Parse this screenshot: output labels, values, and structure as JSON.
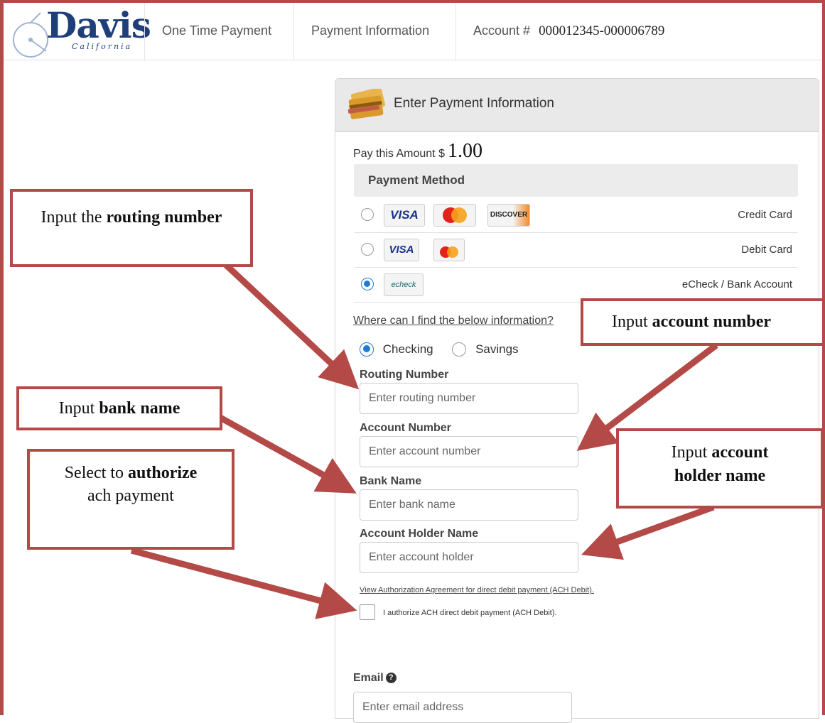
{
  "header": {
    "logo_text": "Davis",
    "logo_sub": "California",
    "nav": [
      "One Time Payment",
      "Payment Information"
    ],
    "account_label": "Account #",
    "account_number": "000012345-000006789"
  },
  "panel": {
    "title": "Enter Payment Information",
    "amount_label": "Pay this Amount $",
    "amount_value": "1.00",
    "payment_method_heading": "Payment Method",
    "methods": [
      {
        "label": "Credit Card",
        "selected": false,
        "logos": [
          "VISA",
          "MasterCard",
          "DISCOVER"
        ]
      },
      {
        "label": "Debit Card",
        "selected": false,
        "logos": [
          "VISA",
          "Debit"
        ]
      },
      {
        "label": "eCheck / Bank Account",
        "selected": true,
        "logos": [
          "echeck"
        ]
      }
    ],
    "where_link": "Where can I find the below information?",
    "account_types": {
      "checking": "Checking",
      "savings": "Savings",
      "selected": "checking"
    },
    "fields": {
      "routing": {
        "label": "Routing Number",
        "placeholder": "Enter routing number"
      },
      "account": {
        "label": "Account Number",
        "placeholder": "Enter account number"
      },
      "bank": {
        "label": "Bank Name",
        "placeholder": "Enter bank name"
      },
      "holder": {
        "label": "Account Holder Name",
        "placeholder": "Enter account holder"
      }
    },
    "auth_link": "View Authorization Agreement for direct debit payment (ACH Debit).",
    "auth_checkbox": "I authorize ACH direct debit payment (ACH Debit).",
    "email": {
      "label": "Email",
      "placeholder": "Enter email address"
    }
  },
  "callouts": {
    "routing": {
      "pre": "Input the ",
      "bold": "routing number",
      "post": ""
    },
    "account": {
      "pre": "Input ",
      "bold": "account number",
      "post": ""
    },
    "bank": {
      "pre": "Input ",
      "bold": "bank name",
      "post": ""
    },
    "authorize": {
      "pre": "Select to ",
      "bold": "authorize",
      "post": " ach payment"
    },
    "holder": {
      "pre": "Input ",
      "bold": "account holder name",
      "post": ""
    }
  },
  "colors": {
    "callout_border": "#b34a47",
    "radio_selected": "#1e7bd6",
    "logo": "#1f3f7a"
  }
}
